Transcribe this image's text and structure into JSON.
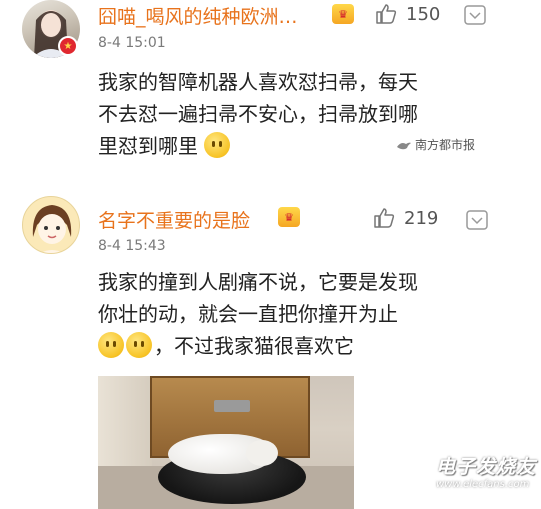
{
  "comments": [
    {
      "username": "囧喵_喝风的纯种欧洲…",
      "crown_badge": "vip-crown",
      "timestamp": "8-4 15:01",
      "like_count": "150",
      "lines": [
        "我家的智障机器人喜欢怼扫帚，每天",
        "不去怼一遍扫帚不安心，扫帚放到哪",
        "里怼到哪里"
      ],
      "avatar_badge": "verified-badge"
    },
    {
      "username": "名字不重要的是脸",
      "crown_badge": "vip-crown",
      "timestamp": "8-4 15:43",
      "like_count": "219",
      "lines": [
        "我家的撞到人剧痛不说，它要是发现",
        "你壮的动，就会一直把你撞开为止",
        "，不过我家猫很喜欢它"
      ],
      "photo": "cat-on-robot-vacuum"
    }
  ],
  "watermarks": {
    "source": "南方都市报",
    "site_name": "电子发烧友",
    "site_url": "www.elecfans.com"
  },
  "colors": {
    "username": "#e8731c",
    "text": "#222222",
    "meta": "#7a7a7a"
  }
}
